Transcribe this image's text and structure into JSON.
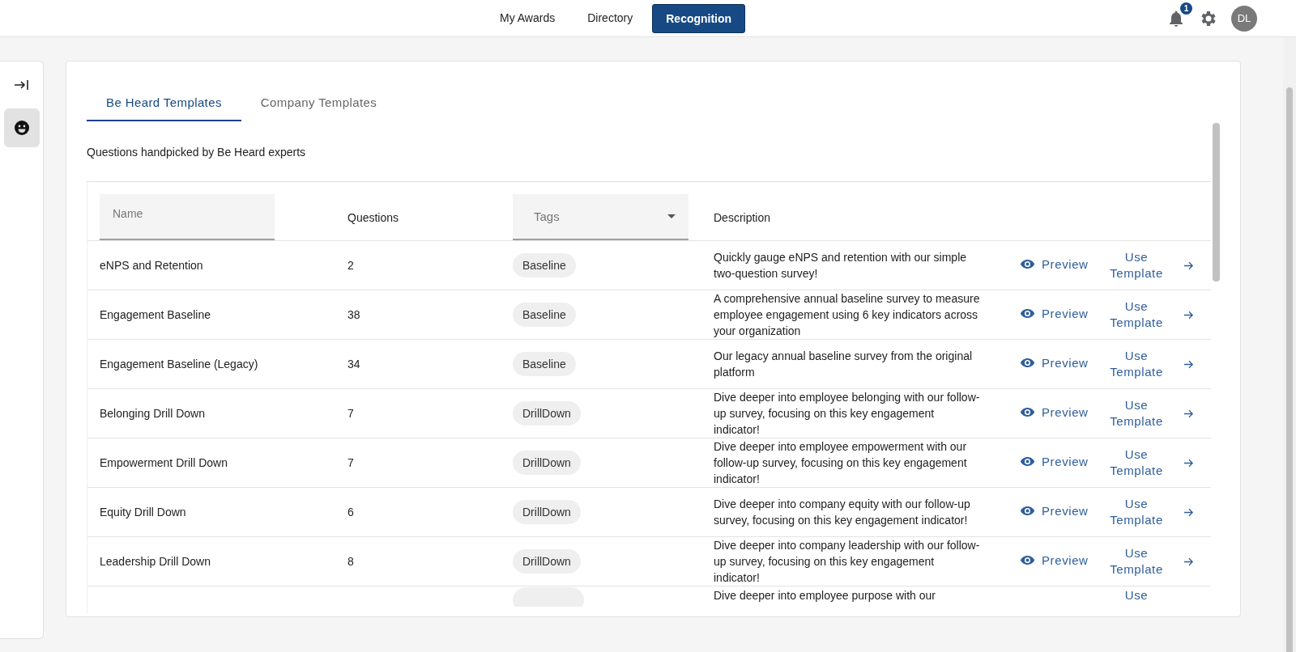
{
  "nav": [
    {
      "label": "My Awards",
      "selected": false
    },
    {
      "label": "Directory",
      "selected": false
    },
    {
      "label": "Recognition",
      "selected": true
    }
  ],
  "notifications": {
    "count": "1"
  },
  "avatar": {
    "initials": "DL"
  },
  "tabs": [
    {
      "label": "Be Heard Templates",
      "selected": true
    },
    {
      "label": "Company Templates",
      "selected": false
    }
  ],
  "subtitle": "Questions handpicked by Be Heard experts",
  "table": {
    "name_filter": {
      "placeholder": "Name"
    },
    "questions_header": "Questions",
    "tags_filter": {
      "placeholder": "Tags"
    },
    "description_header": "Description",
    "rows": [
      {
        "kind": "full",
        "name": "eNPS and Retention",
        "questions": "2",
        "tag": "Baseline",
        "description": "Quickly gauge eNPS and retention with our simple two-question survey!",
        "preview": "Preview",
        "use": "Use Template"
      },
      {
        "kind": "full",
        "name": "Engagement Baseline",
        "questions": "38",
        "tag": "Baseline",
        "description": "A comprehensive annual baseline survey to measure employee engagement using 6 key indicators across your organization",
        "preview": "Preview",
        "use": "Use Template"
      },
      {
        "kind": "full",
        "name": "Engagement Baseline (Legacy)",
        "questions": "34",
        "tag": "Baseline",
        "description": "Our legacy annual baseline survey from the original platform",
        "preview": "Preview",
        "use": "Use Template"
      },
      {
        "kind": "full",
        "name": "Belonging Drill Down",
        "questions": "7",
        "tag": "DrillDown",
        "description": "Dive deeper into employee belonging with our follow-up survey, focusing on this key engagement indicator!",
        "preview": "Preview",
        "use": "Use Template"
      },
      {
        "kind": "full",
        "name": "Empowerment Drill Down",
        "questions": "7",
        "tag": "DrillDown",
        "description": "Dive deeper into employee empowerment with our follow-up survey, focusing on this key engagement indicator!",
        "preview": "Preview",
        "use": "Use Template"
      },
      {
        "kind": "full",
        "name": "Equity Drill Down",
        "questions": "6",
        "tag": "DrillDown",
        "description": "Dive deeper into company equity with our follow-up survey, focusing on this key engagement indicator!",
        "preview": "Preview",
        "use": "Use Template"
      },
      {
        "kind": "full",
        "name": "Leadership Drill Down",
        "questions": "8",
        "tag": "DrillDown",
        "description": "Dive deeper into company leadership with our follow-up survey, focusing on this key engagement indicator!",
        "preview": "Preview",
        "use": "Use Template"
      },
      {
        "kind": "partial",
        "description": "Dive deeper into employee purpose with our",
        "use": "Use"
      }
    ]
  }
}
